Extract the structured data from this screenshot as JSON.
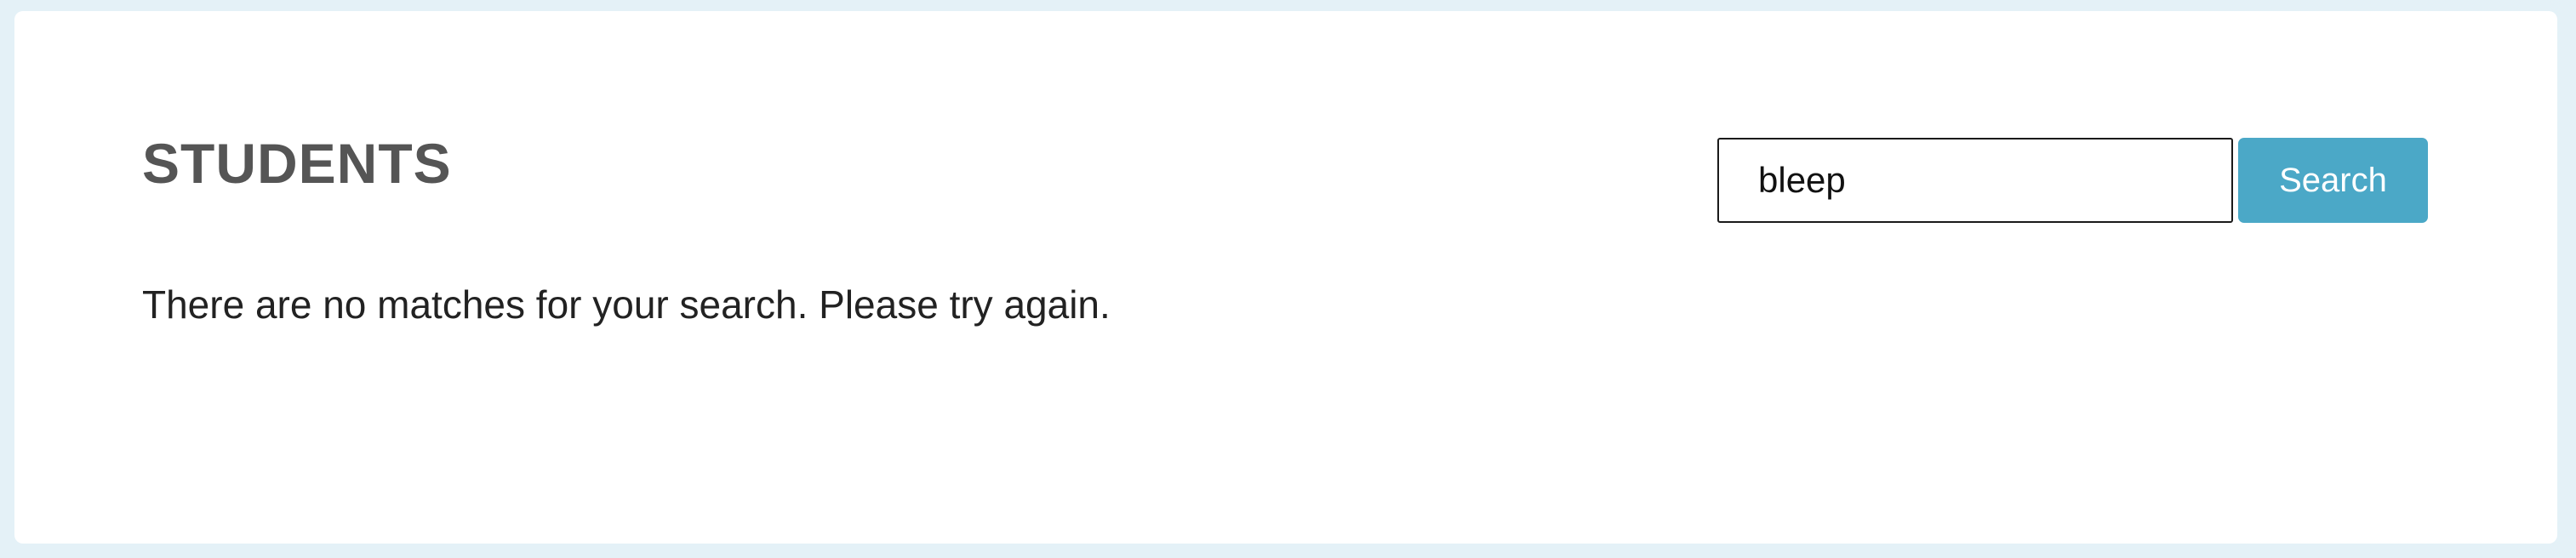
{
  "page": {
    "title": "STUDENTS",
    "empty_message": "There are no matches for your search. Please try again."
  },
  "search": {
    "value": "bleep",
    "button_label": "Search"
  },
  "colors": {
    "page_background": "#e4f1f7",
    "panel_background": "#ffffff",
    "title_text": "#555555",
    "body_text": "#222222",
    "button_background": "#4ba8c7",
    "button_text": "#ffffff"
  }
}
